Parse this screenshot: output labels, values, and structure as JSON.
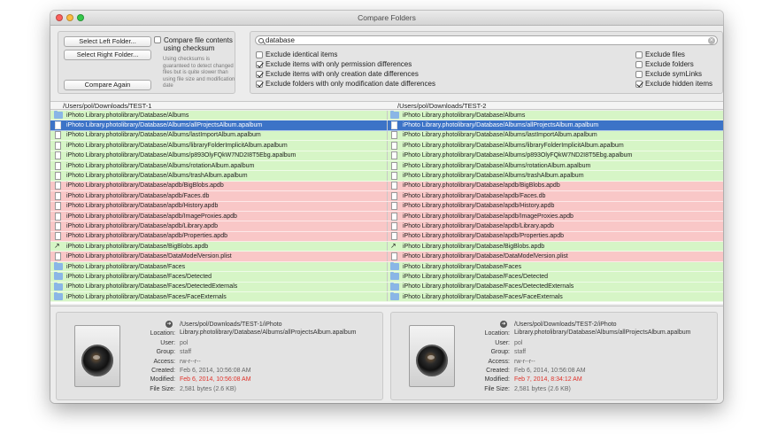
{
  "window": {
    "title": "Compare Folders"
  },
  "controls": {
    "select_left": "Select Left Folder...",
    "select_right": "Select Right Folder...",
    "compare_again": "Compare Again",
    "checksum_label": "Compare file contents using checksum",
    "checksum_note": "Using checksums is guaranteed to detect changed files but is quite slower than using file size and modification date"
  },
  "filters": {
    "search_value": "database",
    "options_left": [
      {
        "label": "Exclude identical items",
        "checked": false
      },
      {
        "label": "Exclude items with only permission differences",
        "checked": true
      },
      {
        "label": "Exclude items with only creation date differences",
        "checked": true
      },
      {
        "label": "Exclude folders with only modification date differences",
        "checked": true
      }
    ],
    "options_right": [
      {
        "label": "Exclude files",
        "checked": false
      },
      {
        "label": "Exclude folders",
        "checked": false
      },
      {
        "label": "Exclude symLinks",
        "checked": false
      },
      {
        "label": "Exclude hidden items",
        "checked": true
      }
    ]
  },
  "columns": {
    "left": "/Users/pol/Downloads/TEST-1",
    "right": "/Users/pol/Downloads/TEST-2"
  },
  "rows": [
    {
      "name": "iPhoto Library.photolibrary/Database/Albums",
      "icon": "folder",
      "status": "equal"
    },
    {
      "name": "iPhoto Library.photolibrary/Database/Albums/allProjectsAlbum.apalbum",
      "icon": "file",
      "status": "selected"
    },
    {
      "name": "iPhoto Library.photolibrary/Database/Albums/lastImportAlbum.apalbum",
      "icon": "file",
      "status": "equal"
    },
    {
      "name": "iPhoto Library.photolibrary/Database/Albums/libraryFolderImplicitAlbum.apalbum",
      "icon": "file",
      "status": "equal"
    },
    {
      "name": "iPhoto Library.photolibrary/Database/Albums/p893OlyFQkW7ND2I8T5Ebg.apalbum",
      "icon": "file",
      "status": "equal"
    },
    {
      "name": "iPhoto Library.photolibrary/Database/Albums/rotationAlbum.apalbum",
      "icon": "file",
      "status": "equal"
    },
    {
      "name": "iPhoto Library.photolibrary/Database/Albums/trashAlbum.apalbum",
      "icon": "file",
      "status": "equal"
    },
    {
      "name": "iPhoto Library.photolibrary/Database/apdb/BigBlobs.apdb",
      "icon": "file",
      "status": "diff"
    },
    {
      "name": "iPhoto Library.photolibrary/Database/apdb/Faces.db",
      "icon": "file",
      "status": "diff"
    },
    {
      "name": "iPhoto Library.photolibrary/Database/apdb/History.apdb",
      "icon": "file",
      "status": "diff"
    },
    {
      "name": "iPhoto Library.photolibrary/Database/apdb/ImageProxies.apdb",
      "icon": "file",
      "status": "diff"
    },
    {
      "name": "iPhoto Library.photolibrary/Database/apdb/Library.apdb",
      "icon": "file",
      "status": "diff"
    },
    {
      "name": "iPhoto Library.photolibrary/Database/apdb/Properties.apdb",
      "icon": "file",
      "status": "diff"
    },
    {
      "name": "iPhoto Library.photolibrary/Database/BigBlobs.apdb",
      "icon": "alias",
      "status": "equal"
    },
    {
      "name": "iPhoto Library.photolibrary/Database/DataModelVersion.plist",
      "icon": "file",
      "status": "diff"
    },
    {
      "name": "iPhoto Library.photolibrary/Database/Faces",
      "icon": "folder",
      "status": "equal"
    },
    {
      "name": "iPhoto Library.photolibrary/Database/Faces/Detected",
      "icon": "folder",
      "status": "equal"
    },
    {
      "name": "iPhoto Library.photolibrary/Database/Faces/DetectedExternals",
      "icon": "folder",
      "status": "equal"
    },
    {
      "name": "iPhoto Library.photolibrary/Database/Faces/FaceExternals",
      "icon": "folder",
      "status": "equal"
    }
  ],
  "info_left": {
    "location_label": "Location:",
    "location": "/Users/pol/Downloads/TEST-1/iPhoto Library.photolibrary/Database/Albums/allProjectsAlbum.apalbum",
    "user_label": "User:",
    "user": "pol",
    "group_label": "Group:",
    "group": "staff",
    "access_label": "Access:",
    "access": "rw-r--r--",
    "created_label": "Created:",
    "created": "Feb 6, 2014, 10:56:08 AM",
    "modified_label": "Modified:",
    "modified": "Feb 6, 2014, 10:56:08 AM",
    "size_label": "File Size:",
    "size": "2,581 bytes (2.6 KB)"
  },
  "info_right": {
    "location_label": "Location:",
    "location": "/Users/pol/Downloads/TEST-2/iPhoto Library.photolibrary/Database/Albums/allProjectsAlbum.apalbum",
    "user_label": "User:",
    "user": "pol",
    "group_label": "Group:",
    "group": "staff",
    "access_label": "Access:",
    "access": "rw-r--r--",
    "created_label": "Created:",
    "created": "Feb 6, 2014, 10:56:08 AM",
    "modified_label": "Modified:",
    "modified": "Feb 7, 2014, 8:34:12 AM",
    "size_label": "File Size:",
    "size": "2,581 bytes (2.6 KB)"
  },
  "colors": {
    "equal_row": "#d6f5c6",
    "diff_row": "#f9c7c7",
    "selected_row": "#3c73c7",
    "modified_text": "#e0332b"
  }
}
